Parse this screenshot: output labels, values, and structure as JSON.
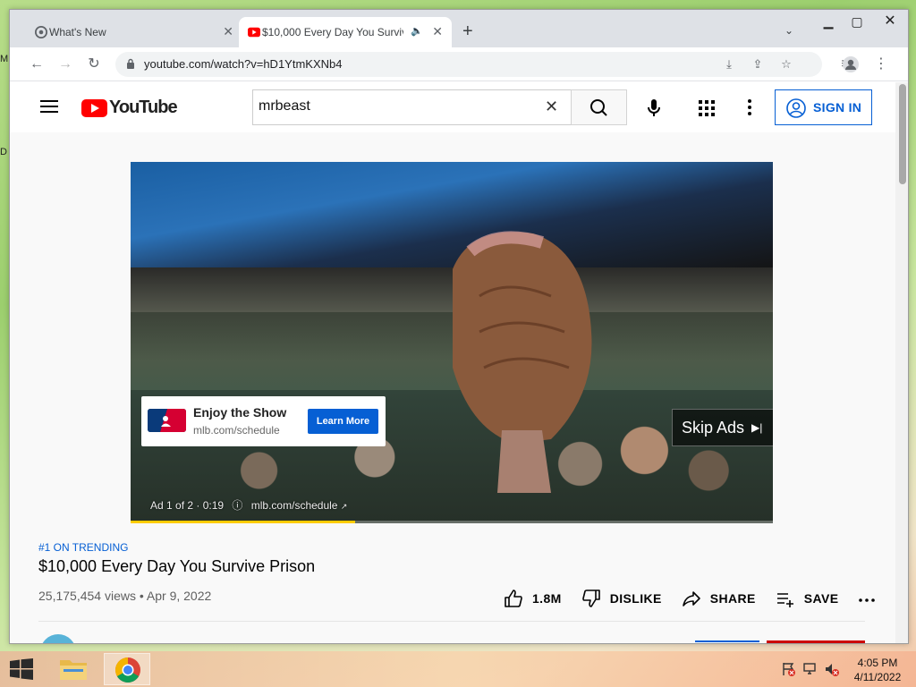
{
  "browser": {
    "tabs": [
      {
        "title": "What's New",
        "active": false,
        "icon": "chrome-icon"
      },
      {
        "title": "$10,000 Every Day You Survive Prison",
        "active": true,
        "icon": "youtube-icon",
        "audio": true
      }
    ],
    "url": "youtube.com/watch?v=hD1YtmKXNb4"
  },
  "youtube": {
    "logo_text": "YouTube",
    "search_value": "mrbeast",
    "sign_in_label": "SIGN IN",
    "ad": {
      "card_title": "Enjoy the Show",
      "card_domain": "mlb.com/schedule",
      "cta_label": "Learn More",
      "skip_label": "Skip Ads",
      "info_counter": "Ad 1 of 2 · 0:19",
      "info_domain": "mlb.com/schedule",
      "progress": 0.35
    },
    "video": {
      "trending": "#1 ON TRENDING",
      "title": "$10,000 Every Day You Survive Prison",
      "views": "25,175,454 views",
      "date": "Apr 9, 2022",
      "meta_sep": "•",
      "likes": "1.8M",
      "dislike_label": "DISLIKE",
      "share_label": "SHARE",
      "save_label": "SAVE"
    }
  },
  "taskbar": {
    "time": "4:05 PM",
    "date": "4/11/2022"
  },
  "colors": {
    "yt_red": "#ff0000",
    "link_blue": "#065fd4",
    "ad_progress": "#ffcc00"
  }
}
